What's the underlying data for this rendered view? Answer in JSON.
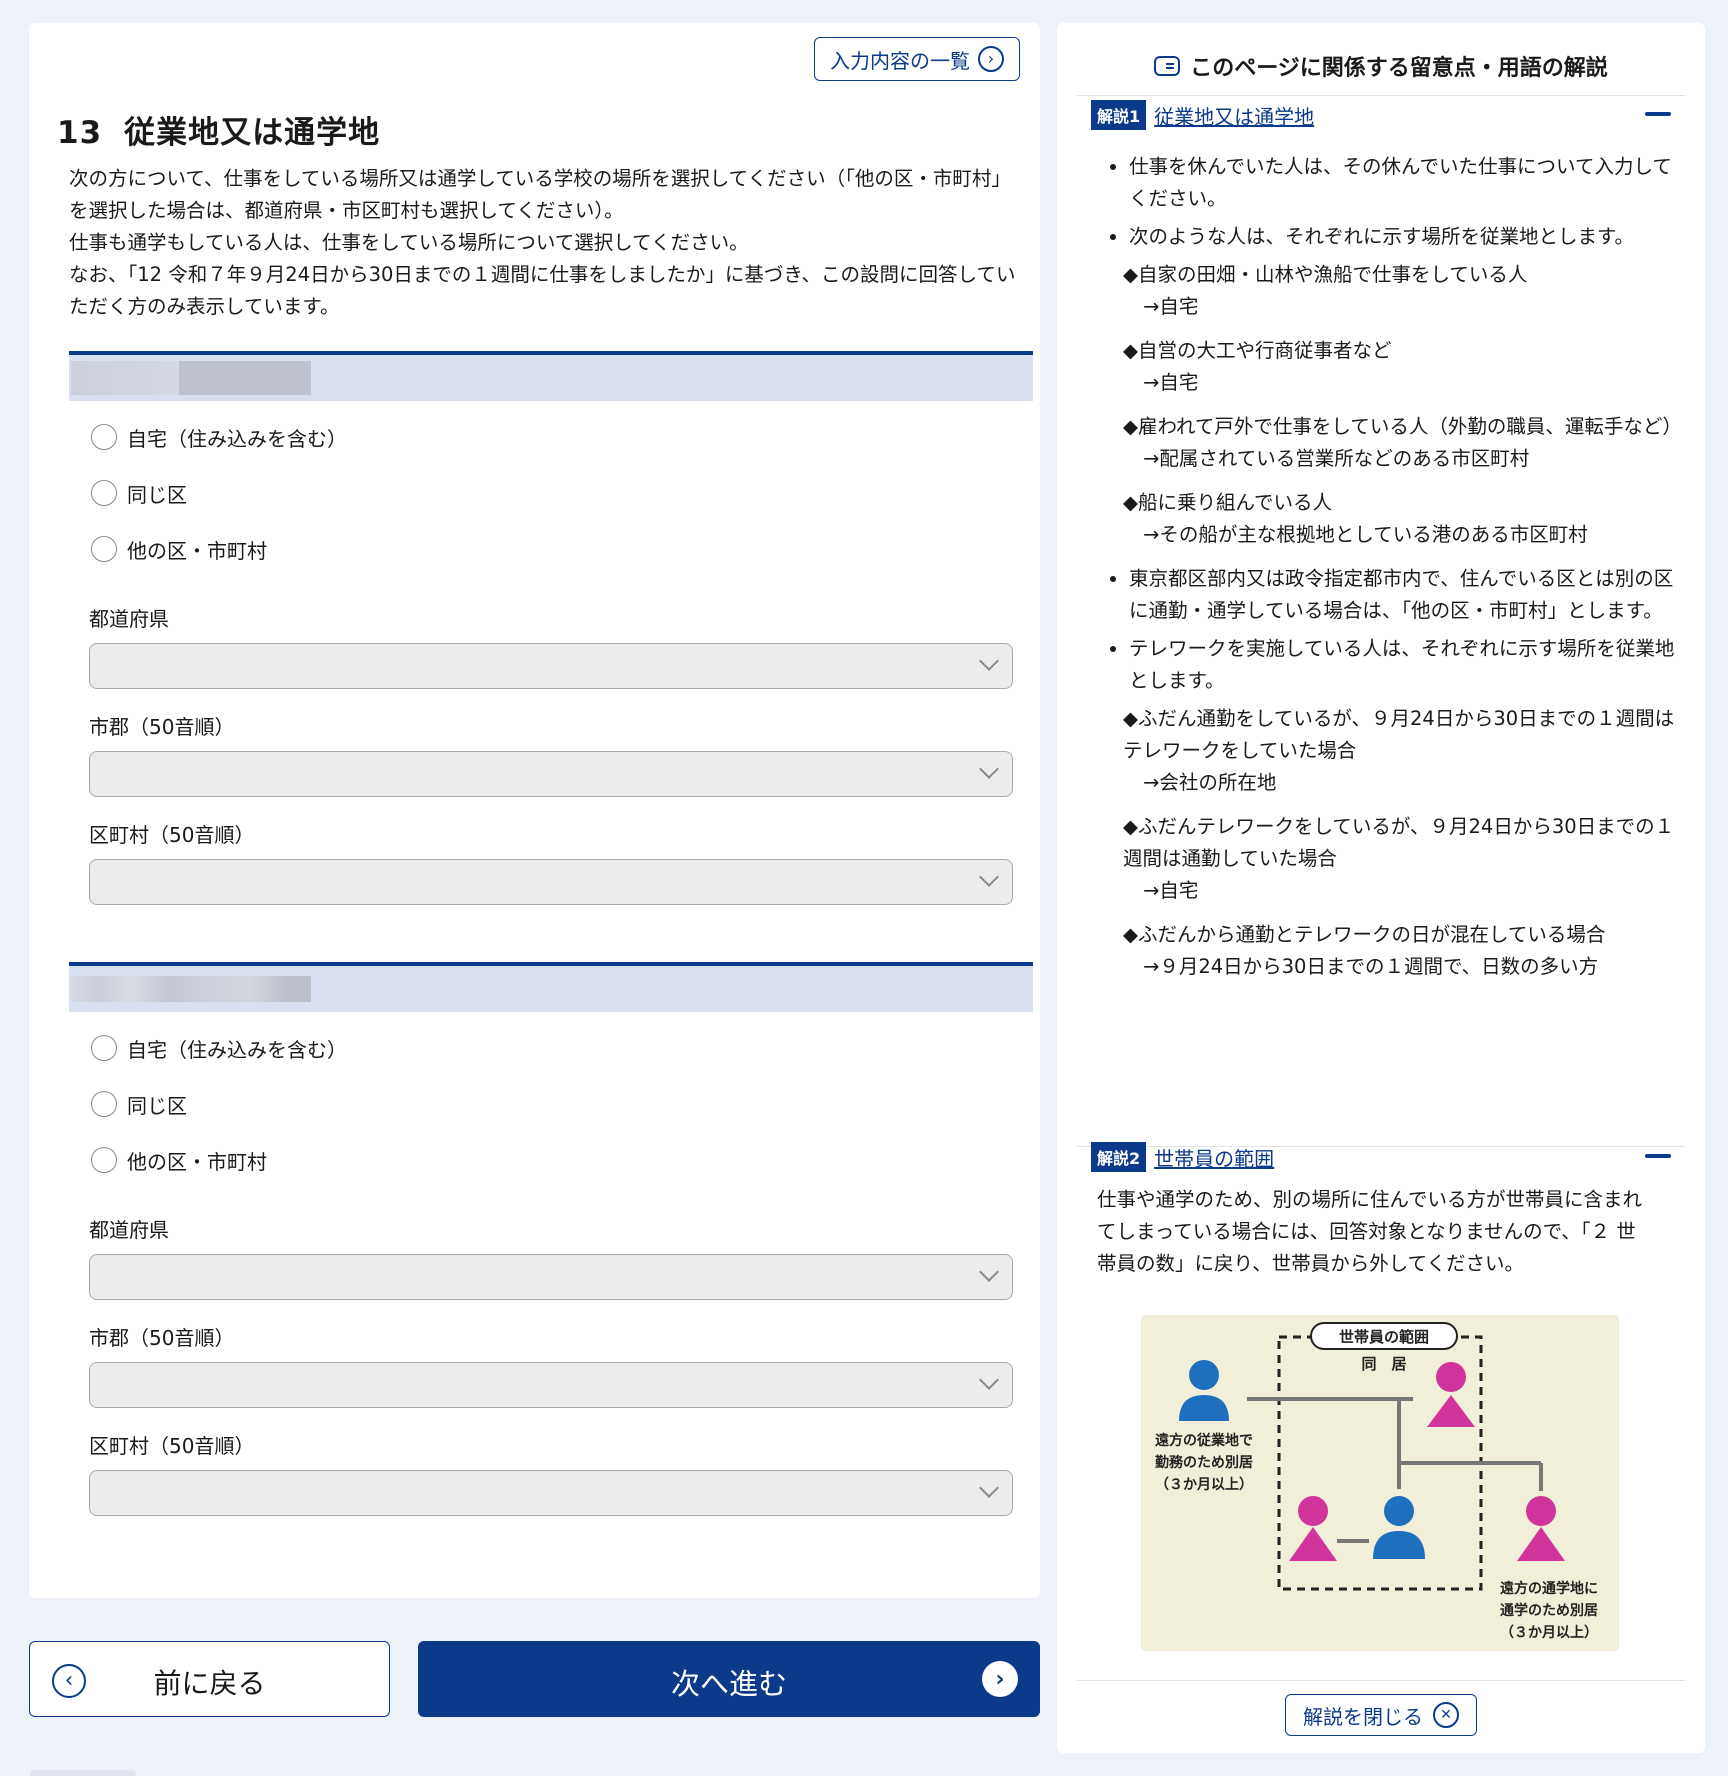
{
  "header": {
    "list_button": "入力内容の一覧",
    "question_number": "13",
    "question_title": "従業地又は通学地"
  },
  "intro": [
    "次の方について、仕事をしている場所又は通学している学校の場所を選択してください（「他の区・市町村」を選択した場合は、都道府県・市区町村も選択してください）。",
    "仕事も通学もしている人は、仕事をしている場所について選択してください。",
    "なお、「12 令和７年９月24日から30日までの１週間に仕事をしましたか」に基づき、この設問に回答していただく方のみ表示しています。"
  ],
  "sections": [
    {
      "options": [
        "自宅（住み込みを含む）",
        "同じ区",
        "他の区・市町村"
      ],
      "labels": [
        "都道府県",
        "市郡（50音順）",
        "区町村（50音順）"
      ]
    },
    {
      "options": [
        "自宅（住み込みを含む）",
        "同じ区",
        "他の区・市町村"
      ],
      "labels": [
        "都道府県",
        "市郡（50音順）",
        "区町村（50音順）"
      ]
    }
  ],
  "nav": {
    "back": "前に戻る",
    "next": "次へ進む"
  },
  "side": {
    "title": "このページに関係する留意点・用語の解説",
    "exp1": {
      "tag": "解説1",
      "title": "従業地又は通学地",
      "b1": "仕事を休んでいた人は、その休んでいた仕事について入力してください。",
      "b2": "次のような人は、それぞれに示す場所を従業地とします。",
      "s1a": "◆自家の田畑・山林や漁船で仕事をしている人",
      "s1b": "→自宅",
      "s2a": "◆自営の大工や行商従事者など",
      "s2b": "→自宅",
      "s3a": "◆雇われて戸外で仕事をしている人（外勤の職員、運転手など）",
      "s3b": "→配属されている営業所などのある市区町村",
      "s4a": "◆船に乗り組んでいる人",
      "s4b": "→その船が主な根拠地としている港のある市区町村",
      "b3": "東京都区部内又は政令指定都市内で、住んでいる区とは別の区に通勤・通学している場合は、「他の区・市町村」とします。",
      "b4": "テレワークを実施している人は、それぞれに示す場所を従業地とします。",
      "t1a": "◆ふだん通勤をしているが、９月24日から30日までの１週間はテレワークをしていた場合",
      "t1b": "→会社の所在地",
      "t2a": "◆ふだんテレワークをしているが、９月24日から30日までの１週間は通勤していた場合",
      "t2b": "→自宅",
      "t3a": "◆ふだんから通勤とテレワークの日が混在している場合",
      "t3b": "→９月24日から30日までの１週間で、日数の多い方"
    },
    "exp2": {
      "tag": "解説2",
      "title": "世帯員の範囲",
      "text": "仕事や通学のため、別の場所に住んでいる方が世帯員に含まれてしまっている場合には、回答対象となりませんので、「２ 世帯員の数」に戻り、世帯員から外してください。",
      "diagram": {
        "range_label": "世帯員の範囲",
        "cohabit": "同　居",
        "left_1": "遠方の従業地で",
        "left_2": "勤務のため別居",
        "left_3": "（３か月以上）",
        "right_1": "遠方の通学地に",
        "right_2": "通学のため別居",
        "right_3": "（３か月以上）"
      }
    },
    "close": "解説を閉じる"
  }
}
